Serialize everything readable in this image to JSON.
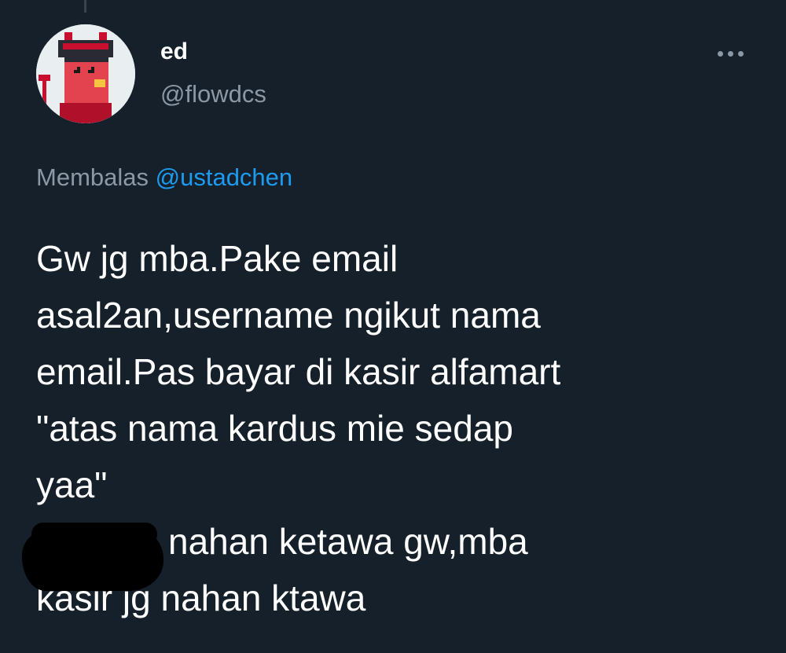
{
  "tweet": {
    "author": {
      "display_name": "ed",
      "handle": "@flowdcs",
      "avatar_icon": "pixel-art-devil-avatar-icon"
    },
    "more_icon": "more-horizontal-icon",
    "reply_context": {
      "prefix": "Membalas",
      "mention": "@ustadchen"
    },
    "text_lines": [
      "Gw jg mba.Pake email",
      "asal2an,username ngikut nama",
      "email.Pas bayar di kasir alfamart",
      "\"atas nama kardus mie sedap",
      "yaa\"",
      "nahan ketawa gw,mba",
      "kasir jg nahan ktawa"
    ]
  },
  "colors": {
    "background": "#15202b",
    "primary_text": "#ffffff",
    "secondary_text": "#8b98a5",
    "link": "#1d9bf0",
    "redaction": "#000000"
  }
}
